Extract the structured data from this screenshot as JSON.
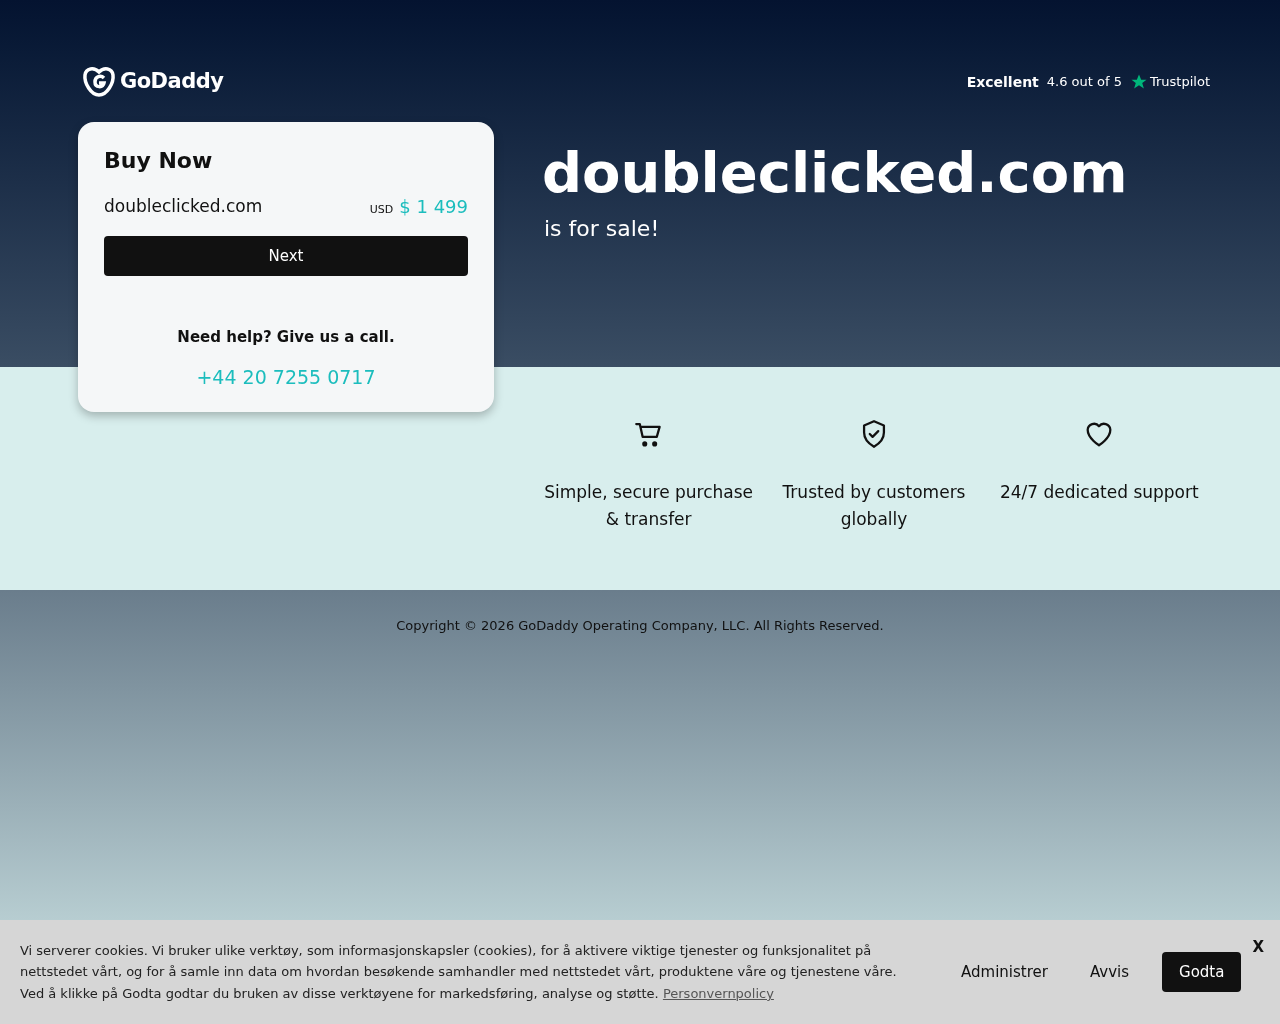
{
  "header": {
    "logo": "GoDaddy",
    "rating": {
      "label": "Excellent",
      "score": "4.6 out of 5",
      "brand": "Trustpilot"
    }
  },
  "buy_card": {
    "title": "Buy Now",
    "domain": "doubleclicked.com",
    "currency": "USD",
    "price": "$ 1 499",
    "button": "Next",
    "help": "Need help? Give us a call.",
    "phone": "+44 20 7255 0717"
  },
  "hero": {
    "domain": "doubleclicked.com",
    "subtitle": "is for sale!"
  },
  "features": [
    {
      "kind": "cart",
      "text": "Simple, secure purchase & transfer"
    },
    {
      "kind": "shield",
      "text": "Trusted by customers globally"
    },
    {
      "kind": "heart",
      "text": "24/7 dedicated support"
    }
  ],
  "footer": {
    "copyright": "Copyright © 2026 GoDaddy Operating Company, LLC. All Rights Reserved."
  },
  "cookie_banner": {
    "text": "Vi serverer cookies. Vi bruker ulike verktøy, som informasjonskapsler (cookies), for å aktivere viktige tjenester og funksjonalitet på nettstedet vårt, og for å samle inn data om hvordan besøkende samhandler med nettstedet vårt, produktene våre og tjenestene våre. Ved å klikke på Godta godtar du bruken av disse verktøyene for markedsføring, analyse og støtte.",
    "link": "Personvernpolicy",
    "buttons": [
      "Administrer",
      "Avvis",
      "Godta"
    ],
    "close": "X"
  }
}
